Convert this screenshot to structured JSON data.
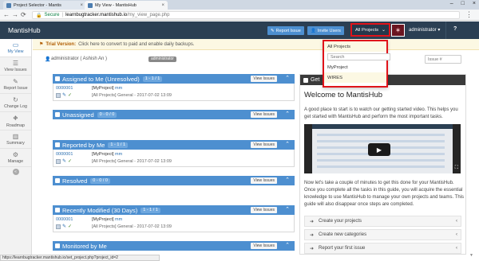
{
  "browser": {
    "tabs": [
      {
        "title": "Project Selector - Mantis"
      },
      {
        "title": "My View - MantisHub"
      }
    ],
    "secure_label": "Secure",
    "url_host": "learnbugtracker.mantishub.io",
    "url_path": "/my_view_page.php"
  },
  "appbar": {
    "brand": "MantisHub",
    "report_issue": "Report Issue",
    "invite_users": "Invite Users",
    "project_selector": "All Projects",
    "user": "administrator",
    "help": "?"
  },
  "sidebar": {
    "items": [
      {
        "label": "My View",
        "icon": "monitor-icon"
      },
      {
        "label": "View Issues",
        "icon": "list-icon"
      },
      {
        "label": "Report Issue",
        "icon": "pencil-icon"
      },
      {
        "label": "Change Log",
        "icon": "refresh-icon"
      },
      {
        "label": "Roadmap",
        "icon": "road-icon"
      },
      {
        "label": "Summary",
        "icon": "bar-chart-icon"
      },
      {
        "label": "Manage",
        "icon": "gears-icon"
      }
    ]
  },
  "trial": {
    "title": "Trial Version:",
    "message": "Click here to convert to paid and enable daily backups."
  },
  "user": {
    "name": "administrator ( Ashish An )",
    "role": "administrator",
    "issue_search_placeholder": "Issue #"
  },
  "widgets": [
    {
      "title": "Assigned to Me (Unresolved)",
      "count": "1 - 1 / 1",
      "button": "View Issues",
      "issue": {
        "id": "0000001",
        "project": "[MyProject]",
        "summary": "mm",
        "meta": "[All Projects] General - 2017-07-02 13:09"
      }
    },
    {
      "title": "Unassigned",
      "count": "0 - 0 / 0",
      "button": "View Issues"
    },
    {
      "title": "Reported by Me",
      "count": "1 - 1 / 1",
      "button": "View Issues",
      "issue": {
        "id": "0000001",
        "project": "[MyProject]",
        "summary": "mm",
        "meta": "[All Projects] General - 2017-07-02 13:09"
      }
    },
    {
      "title": "Resolved",
      "count": "0 - 0 / 0",
      "button": "View Issues"
    },
    {
      "title": "Recently Modified (30 Days)",
      "count": "1 - 1 / 1",
      "button": "View Issues",
      "issue": {
        "id": "0000001",
        "project": "[MyProject]",
        "summary": "mm",
        "meta": "[All Projects] General - 2017-07-02 13:09"
      }
    },
    {
      "title": "Monitored by Me",
      "count": "",
      "button": "View Issues"
    }
  ],
  "getstarted": {
    "header": "Get",
    "title": "Welcome to MantisHub",
    "intro": "A good place to start is to watch our getting started video. This helps you get started with MantisHub and perform the most important tasks.",
    "outro": "Now let's take a couple of minutes to get this done for your MantisHub. Once you complete all the tasks in this guide, you will acquire the essential knowledge to use MantisHub to manage your own projects and teams. This guide will also disappear once steps are completed.",
    "steps": [
      "Create your projects",
      "Create new categories",
      "Report your first issue"
    ]
  },
  "dropdown": {
    "items_top": "All Projects",
    "search_placeholder": "Search",
    "items": [
      "MyProject",
      "WIRES"
    ]
  },
  "statusbar": "https://learnbugtracker.mantishub.io/set_project.php?project_id=2",
  "colors": {
    "navbar": "#2b3f53",
    "widget_header": "#4d8fd0",
    "highlight": "#e0131a"
  }
}
